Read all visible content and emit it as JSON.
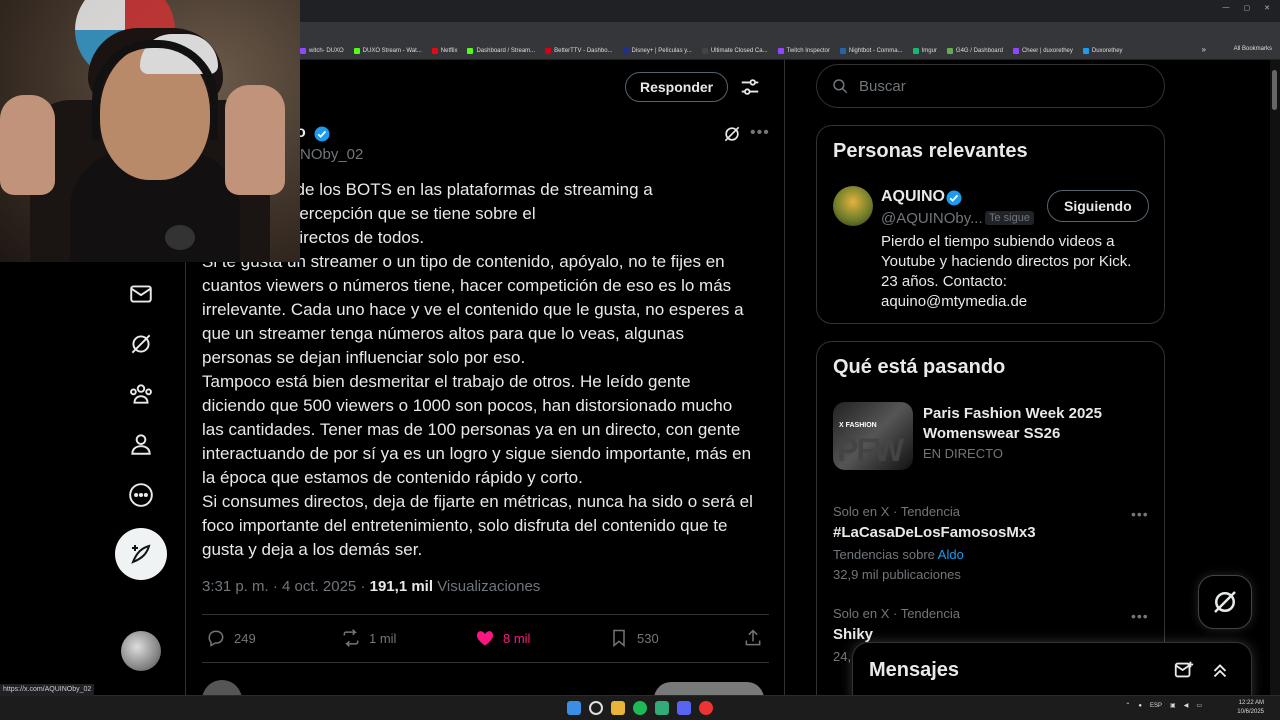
{
  "browser": {
    "bookmarks": [
      {
        "label": "witch- DUXO",
        "color": "#9146ff"
      },
      {
        "label": "DUXO Stream - Wat...",
        "color": "#53fc18"
      },
      {
        "label": "Netflix",
        "color": "#e50914"
      },
      {
        "label": "Dashboard / Stream...",
        "color": "#53fc18"
      },
      {
        "label": "BetterTTV - Dashbo...",
        "color": "#d50014"
      },
      {
        "label": "Disney+ | Películas y...",
        "color": "#1f2f8f"
      },
      {
        "label": "Ultimate Closed Ca...",
        "color": "#444"
      },
      {
        "label": "Twitch Inspector",
        "color": "#9146ff"
      },
      {
        "label": "Nightbot - Comma...",
        "color": "#26a"
      },
      {
        "label": "Imgur",
        "color": "#1bb76e"
      },
      {
        "label": "G4G / Dashboard",
        "color": "#6a5"
      },
      {
        "label": "Cheer | duxorethey",
        "color": "#9146ff"
      },
      {
        "label": "Duxorethey",
        "color": "#1d9bf0"
      }
    ],
    "all_bookmarks_label": "All Bookmarks",
    "more_bookmarks_icon": "chevron-double-right-icon"
  },
  "header": {
    "reply_label": "Responder"
  },
  "post": {
    "author_name_partial": "o",
    "author_handle_partial": "NOby_02",
    "text_lines": [
      "odo el tema de los BOTS en las plataformas de streaming a",
      "o mucho la percepción que se tiene sobre el",
      "ento en los directos de todos.",
      "Si te gusta un streamer o un tipo de contenido, apóyalo, no te fijes en",
      "cuantos viewers o números tiene, hacer competición de eso es lo más",
      "irrelevante. Cada uno hace y ve el contenido que le gusta, no esperes a",
      "que un streamer tenga números altos para que lo veas, algunas",
      "personas se dejan influenciar solo por eso.",
      "Tampoco está bien desmeritar el trabajo de otros. He leído gente",
      "diciendo que 500 viewers o 1000 son pocos, han distorsionado mucho",
      "las cantidades. Tener mas de 100 personas ya en un directo, con gente",
      "interactuando de por sí ya es un logro y sigue siendo importante, más en",
      "la época que estamos de contenido rápido y corto.",
      "Si consumes directos, deja de fijarte en métricas, nunca ha sido o será el",
      "foco importante del entretenimiento, solo disfruta del contenido que te",
      "gusta y deja a los demás ser."
    ],
    "time": "3:31 p. m.",
    "date": "4 oct. 2025",
    "views_count": "191,1 mil",
    "views_label": "Visualizaciones",
    "replies": "249",
    "reposts": "1 mil",
    "likes": "8 mil",
    "bookmarks": "530"
  },
  "sidebar": {
    "search_placeholder": "Buscar",
    "relevant": {
      "title": "Personas relevantes",
      "name": "AQUINO",
      "handle": "@AQUINOby...",
      "follows_you": "Te sigue",
      "follow_label": "Siguiendo",
      "bio": "Pierdo el tiempo subiendo videos a Youtube y haciendo directos por Kick. 23 años. Contacto: aquino@mtymedia.de"
    },
    "trends": {
      "title": "Qué está pasando",
      "featured": {
        "title": "Paris Fashion Week 2025 Womenswear SS26",
        "status": "EN DIRECTO",
        "img_brand": "X FASHION",
        "img_big": "PFW"
      },
      "items": [
        {
          "context": "Solo en X · Tendencia",
          "name": "#LaCasaDeLosFamososMx3",
          "sub_prefix": "Tendencias sobre ",
          "sub_link": "Aldo",
          "count": "32,9 mil publicaciones"
        },
        {
          "context": "Solo en X · Tendencia",
          "name": "Shiky",
          "count_partial": "24,"
        }
      ]
    }
  },
  "messages": {
    "title": "Mensajes"
  },
  "status_url": "https://x.com/AQUINOby_02",
  "taskbar": {
    "lang": "ESP",
    "time": "12:22 AM",
    "date": "10/6/2025"
  },
  "colors": {
    "accent": "#1d9bf0",
    "like": "#f91880",
    "border": "#2f3336",
    "muted": "#71767b"
  }
}
